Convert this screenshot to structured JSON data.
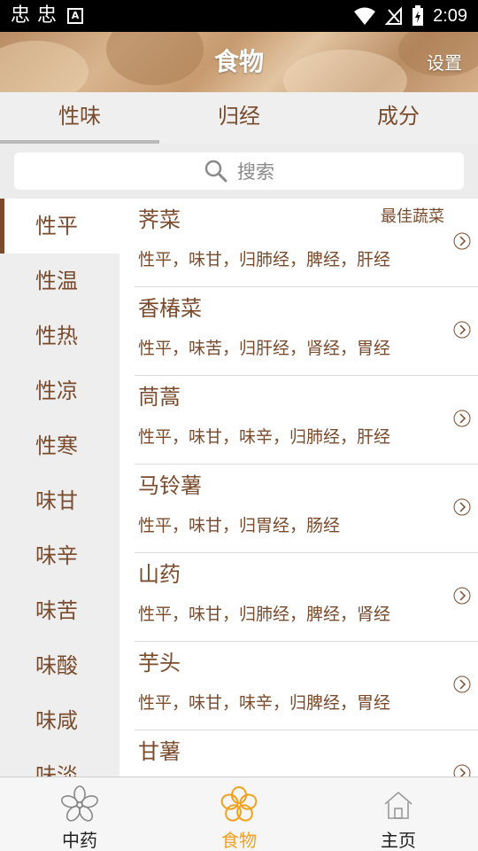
{
  "status_bar": {
    "left_glyphs": [
      "忠",
      "忠"
    ],
    "badge": "A",
    "time": "2:09"
  },
  "header": {
    "title": "食物",
    "settings": "设置"
  },
  "tabs": [
    {
      "label": "性味",
      "active": true
    },
    {
      "label": "归经",
      "active": false
    },
    {
      "label": "成分",
      "active": false
    }
  ],
  "search": {
    "placeholder": "搜索"
  },
  "sidebar": {
    "items": [
      "性平",
      "性温",
      "性热",
      "性凉",
      "性寒",
      "味甘",
      "味辛",
      "味苦",
      "味酸",
      "味咸",
      "味淡"
    ],
    "active_index": 0
  },
  "foods": [
    {
      "name": "荠菜",
      "desc": "性平，味甘，归肺经，脾经，肝经",
      "tag": "最佳蔬菜"
    },
    {
      "name": "香椿菜",
      "desc": "性平，味苦，归肝经，肾经，胃经",
      "tag": ""
    },
    {
      "name": "茼蒿",
      "desc": "性平，味甘，味辛，归肺经，肝经",
      "tag": ""
    },
    {
      "name": "马铃薯",
      "desc": "性平，味甘，归胃经，肠经",
      "tag": ""
    },
    {
      "name": "山药",
      "desc": "性平，味甘，归肺经，脾经，肾经",
      "tag": ""
    },
    {
      "name": "芋头",
      "desc": "性平，味甘，味辛，归脾经，胃经",
      "tag": ""
    },
    {
      "name": "甘薯",
      "desc": "",
      "tag": ""
    }
  ],
  "bottom_nav": [
    {
      "label": "中药",
      "icon": "flower-outline-icon",
      "active": false
    },
    {
      "label": "食物",
      "icon": "flower-icon",
      "active": true
    },
    {
      "label": "主页",
      "icon": "home-icon",
      "active": false
    }
  ],
  "colors": {
    "brown": "#7a4b2c",
    "accent": "#f2a01e",
    "sidebar_bg": "#eeeeee"
  }
}
